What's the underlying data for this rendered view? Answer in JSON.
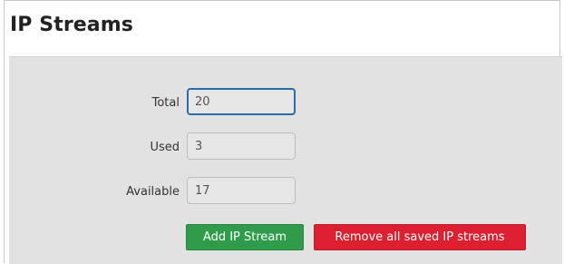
{
  "page": {
    "title": "IP Streams"
  },
  "form": {
    "total": {
      "label": "Total",
      "value": "20"
    },
    "used": {
      "label": "Used",
      "value": "3"
    },
    "available": {
      "label": "Available",
      "value": "17"
    }
  },
  "buttons": {
    "add_label": "Add IP Stream",
    "remove_label": "Remove all saved IP streams"
  },
  "colors": {
    "add_button": "#2e9c4a",
    "remove_button": "#dd2030",
    "active_field_border": "#2c6aa8",
    "panel_background": "#e2e2e2"
  }
}
